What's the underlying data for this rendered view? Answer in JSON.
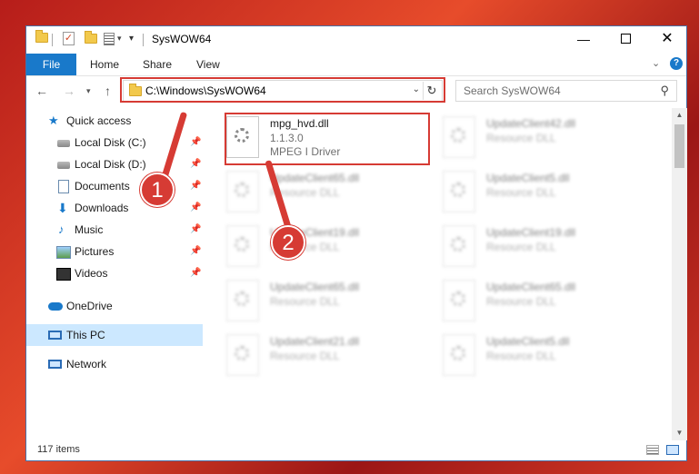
{
  "titlebar": {
    "title": "SysWOW64",
    "window_controls": {
      "minimize": "—",
      "close": "✕"
    }
  },
  "ribbon": {
    "tabs": [
      "File",
      "Home",
      "Share",
      "View"
    ]
  },
  "address": {
    "path": "C:\\Windows\\SysWOW64",
    "search_placeholder": "Search SysWOW64"
  },
  "sidebar": {
    "items": [
      {
        "label": "Quick access",
        "icon": "star-icon",
        "pinned": false
      },
      {
        "label": "Local Disk (C:)",
        "icon": "drive-icon",
        "pinned": true
      },
      {
        "label": "Local Disk (D:)",
        "icon": "drive-icon",
        "pinned": true
      },
      {
        "label": "Documents",
        "icon": "document-icon",
        "pinned": true
      },
      {
        "label": "Downloads",
        "icon": "download-icon",
        "pinned": true
      },
      {
        "label": "Music",
        "icon": "music-icon",
        "pinned": true
      },
      {
        "label": "Pictures",
        "icon": "pictures-icon",
        "pinned": true
      },
      {
        "label": "Videos",
        "icon": "video-icon",
        "pinned": true
      },
      {
        "label": "OneDrive",
        "icon": "cloud-icon",
        "pinned": false
      },
      {
        "label": "This PC",
        "icon": "computer-icon",
        "pinned": false,
        "selected": true
      },
      {
        "label": "Network",
        "icon": "network-icon",
        "pinned": false
      }
    ]
  },
  "files": [
    {
      "name": "mpg_hvd.dll",
      "line2": "1.1.3.0",
      "line3": "MPEG I Driver",
      "blurred": false
    },
    {
      "name": "UpdateClient42.dll",
      "line2": "Resource DLL",
      "blurred": true
    },
    {
      "name": "UpdateClient65.dll",
      "line2": "Resource DLL",
      "blurred": true
    },
    {
      "name": "UpdateClient5.dll",
      "line2": "Resource DLL",
      "blurred": true
    },
    {
      "name": "UpdateClient19.dll",
      "line2": "Resource DLL",
      "blurred": true
    },
    {
      "name": "UpdateClient19.dll",
      "line2": "Resource DLL",
      "blurred": true
    },
    {
      "name": "UpdateClient65.dll",
      "line2": "Resource DLL",
      "blurred": true
    },
    {
      "name": "UpdateClient65.dll",
      "line2": "Resource DLL",
      "blurred": true
    },
    {
      "name": "UpdateClient21.dll",
      "line2": "Resource DLL",
      "blurred": true
    },
    {
      "name": "UpdateClient5.dll",
      "line2": "Resource DLL",
      "blurred": true
    }
  ],
  "status": {
    "item_count": "117 items"
  },
  "callouts": [
    "1",
    "2"
  ],
  "colors": {
    "accent": "#1979ca",
    "highlight": "#d63b34",
    "selected_bg": "#cce8ff"
  }
}
